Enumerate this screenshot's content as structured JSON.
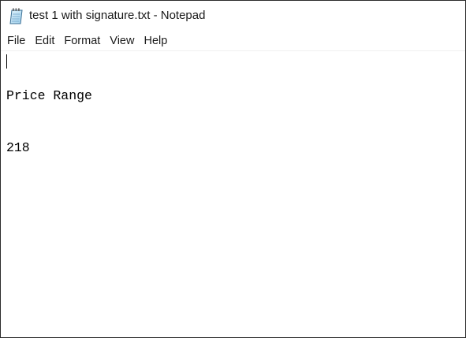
{
  "window": {
    "title": "test 1 with signature.txt - Notepad",
    "app_icon": "notepad-icon"
  },
  "menubar": {
    "items": [
      {
        "label": "File"
      },
      {
        "label": "Edit"
      },
      {
        "label": "Format"
      },
      {
        "label": "View"
      },
      {
        "label": "Help"
      }
    ]
  },
  "editor": {
    "lines": [
      "Price Range",
      "218"
    ]
  }
}
